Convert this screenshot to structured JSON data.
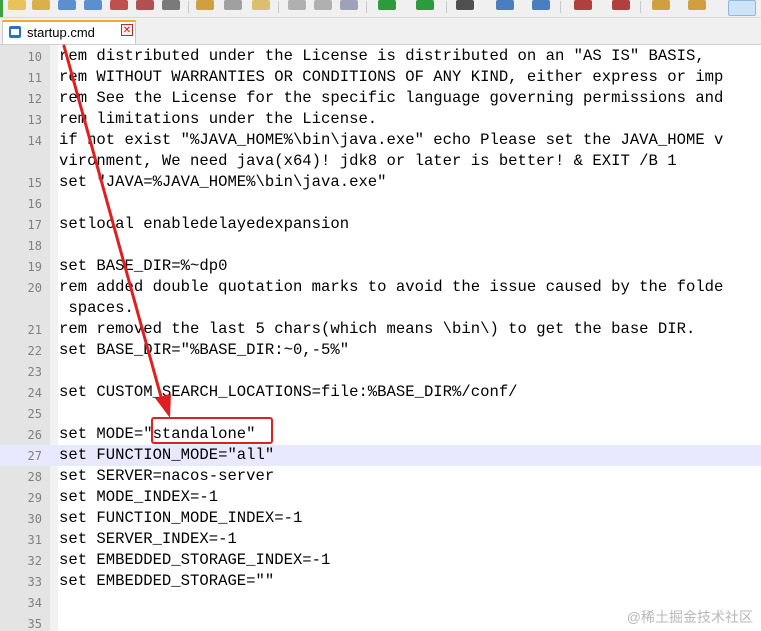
{
  "tab": {
    "label": "startup.cmd"
  },
  "editor": {
    "lines": [
      {
        "num": "10",
        "text": "rem distributed under the License is distributed on an \"AS IS\" BASIS,"
      },
      {
        "num": "11",
        "text": "rem WITHOUT WARRANTIES OR CONDITIONS OF ANY KIND, either express or imp"
      },
      {
        "num": "12",
        "text": "rem See the License for the specific language governing permissions and"
      },
      {
        "num": "13",
        "text": "rem limitations under the License."
      },
      {
        "num": "14",
        "text": "if not exist \"%JAVA_HOME%\\bin\\java.exe\" echo Please set the JAVA_HOME v"
      },
      {
        "num": "",
        "text": "vironment, We need java(x64)! jdk8 or later is better! & EXIT /B 1"
      },
      {
        "num": "15",
        "text": "set \"JAVA=%JAVA_HOME%\\bin\\java.exe\""
      },
      {
        "num": "16",
        "text": ""
      },
      {
        "num": "17",
        "text": "setlocal enabledelayedexpansion"
      },
      {
        "num": "18",
        "text": ""
      },
      {
        "num": "19",
        "text": "set BASE_DIR=%~dp0"
      },
      {
        "num": "20",
        "text": "rem added double quotation marks to avoid the issue caused by the folde"
      },
      {
        "num": "",
        "text": " spaces."
      },
      {
        "num": "21",
        "text": "rem removed the last 5 chars(which means \\bin\\) to get the base DIR."
      },
      {
        "num": "22",
        "text": "set BASE_DIR=\"%BASE_DIR:~0,-5%\""
      },
      {
        "num": "23",
        "text": ""
      },
      {
        "num": "24",
        "text": "set CUSTOM_SEARCH_LOCATIONS=file:%BASE_DIR%/conf/"
      },
      {
        "num": "25",
        "text": ""
      },
      {
        "num": "26",
        "text": "set MODE=\"standalone\""
      },
      {
        "num": "27",
        "text": "set FUNCTION_MODE=\"all\""
      },
      {
        "num": "28",
        "text": "set SERVER=nacos-server"
      },
      {
        "num": "29",
        "text": "set MODE_INDEX=-1"
      },
      {
        "num": "30",
        "text": "set FUNCTION_MODE_INDEX=-1"
      },
      {
        "num": "31",
        "text": "set SERVER_INDEX=-1"
      },
      {
        "num": "32",
        "text": "set EMBEDDED_STORAGE_INDEX=-1"
      },
      {
        "num": "33",
        "text": "set EMBEDDED_STORAGE=\"\""
      },
      {
        "num": "34",
        "text": ""
      },
      {
        "num": "35",
        "text": ""
      }
    ],
    "current_line_index": 19
  },
  "watermark": "@稀土掘金技术社区",
  "colors": {
    "highlight": "#e02020",
    "current_line": "#e8e8ff",
    "tab_accent": "#f4a92a"
  }
}
